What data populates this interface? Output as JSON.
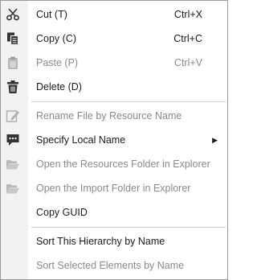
{
  "menu": {
    "items": [
      {
        "label": "Cut (T)",
        "shortcut": "Ctrl+X",
        "icon": "scissors-icon",
        "enabled": true
      },
      {
        "label": "Copy (C)",
        "shortcut": "Ctrl+C",
        "icon": "copy-icon",
        "enabled": true
      },
      {
        "label": "Paste (P)",
        "shortcut": "Ctrl+V",
        "icon": "paste-icon",
        "enabled": false
      },
      {
        "label": "Delete (D)",
        "shortcut": "",
        "icon": "trash-icon",
        "enabled": true
      },
      {
        "label": "Rename File by Resource Name",
        "shortcut": "",
        "icon": "rename-icon",
        "enabled": false
      },
      {
        "label": "Specify Local Name",
        "shortcut": "",
        "icon": "comment-icon",
        "enabled": true,
        "submenu": true
      },
      {
        "label": "Open the Resources Folder in Explorer",
        "shortcut": "",
        "icon": "folder-open-icon",
        "enabled": false
      },
      {
        "label": "Open the Import Folder in Explorer",
        "shortcut": "",
        "icon": "folder-open-icon",
        "enabled": false
      },
      {
        "label": "Copy GUID",
        "shortcut": "",
        "icon": "",
        "enabled": true
      },
      {
        "label": "Sort This Hierarchy by Name",
        "shortcut": "",
        "icon": "",
        "enabled": true
      },
      {
        "label": "Sort Selected Elements by Name",
        "shortcut": "",
        "icon": "",
        "enabled": false
      }
    ],
    "submenu_arrow": "▶"
  }
}
